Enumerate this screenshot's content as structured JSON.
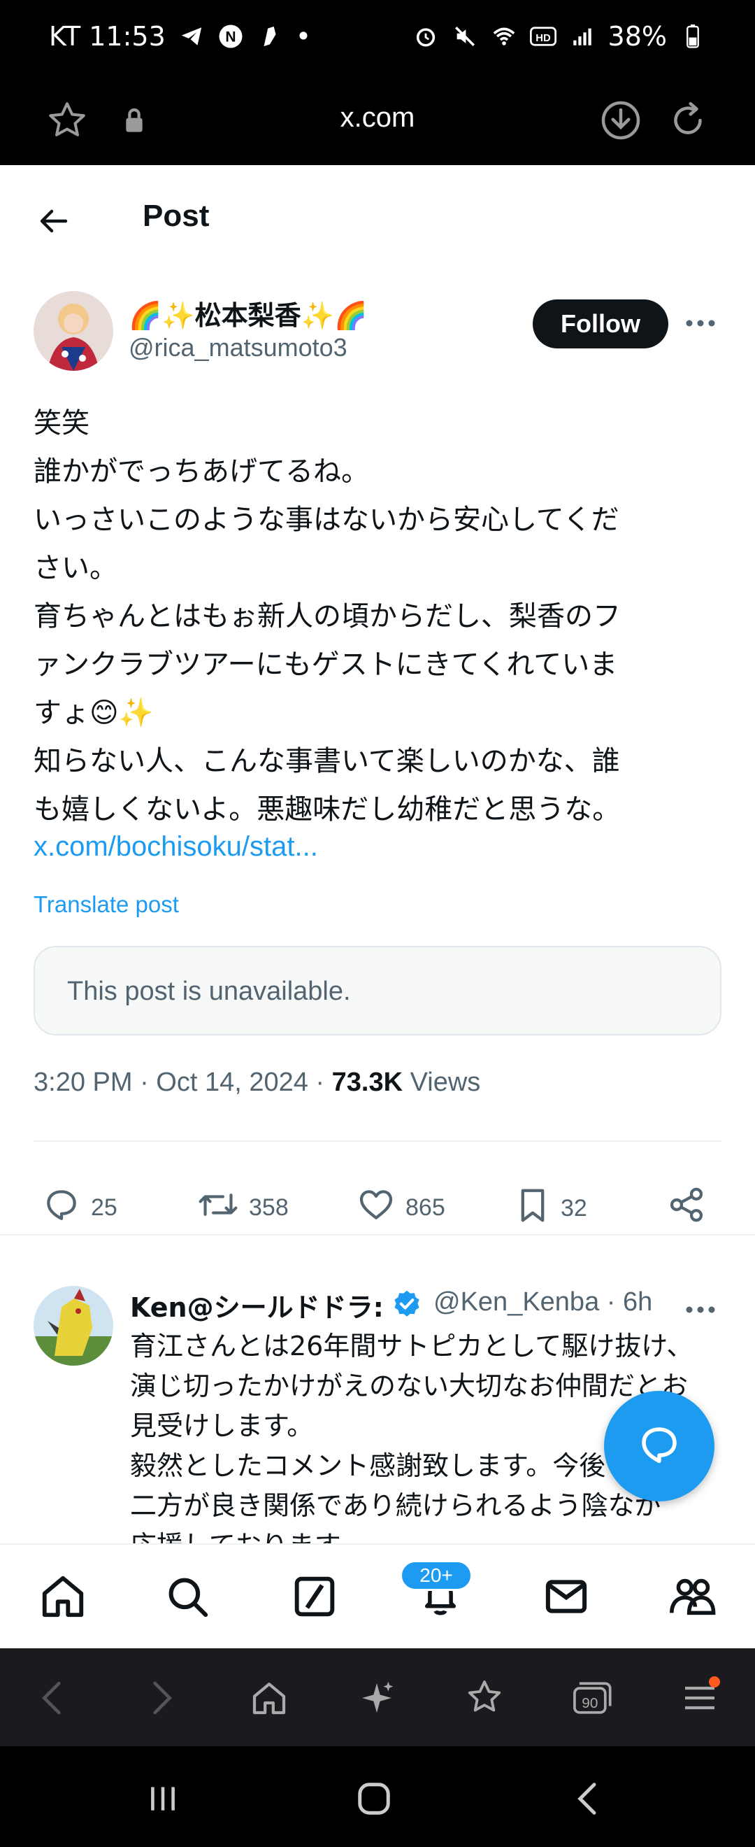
{
  "status_bar": {
    "carrier_time": "KT 11:53",
    "dot": "•",
    "battery": "38%",
    "icons": [
      "telegram-icon",
      "n-app-icon",
      "app-icon",
      "alarm-icon",
      "mute-icon",
      "wifi-icon",
      "hd-icon",
      "signal-icon",
      "battery-icon"
    ]
  },
  "browser": {
    "url": "x.com"
  },
  "header": {
    "title": "Post"
  },
  "post": {
    "author_name": "🌈✨松本梨香✨🌈",
    "author_handle": "@rica_matsumoto3",
    "follow_label": "Follow",
    "text_lines": [
      "笑笑",
      "誰かがでっちあげてるね。",
      "いっさいこのような事はないから安心してくだ",
      "さい。",
      "育ちゃんとはもぉ新人の頃からだし、梨香のフ",
      "ァンクラブツアーにもゲストにきてくれていま",
      "すょ😊✨",
      "知らない人、こんな事書いて楽しいのかな、誰",
      "も嬉しくないよ。悪趣味だし幼稚だと思うな。"
    ],
    "link": "x.com/bochisoku/stat...",
    "translate_label": "Translate post",
    "quoted_unavailable": "This post is unavailable.",
    "timestamp": "3:20 PM · Oct 14, 2024 · ",
    "views_count": "73.3K",
    "views_label": " Views",
    "stats": {
      "replies": "25",
      "reposts": "358",
      "likes": "865",
      "bookmarks": "32"
    }
  },
  "reply": {
    "name": "Ken@シールドドラ:",
    "handle_time": "@Ken_Kenba · 6h",
    "text_lines": [
      "育江さんとは26年間サトピカとして駆け抜け、",
      "演じ切ったかけがえのない大切なお仲間だとお",
      "見受けします。",
      "毅然としたコメント感謝致します。今後",
      "二方が良き関係であり続けられるよう陰なが",
      "応援しております。"
    ]
  },
  "tab_bar": {
    "notifications_badge": "20+"
  },
  "colors": {
    "accent": "#1d9bf0",
    "text": "#0f1419",
    "secondary": "#536471"
  }
}
